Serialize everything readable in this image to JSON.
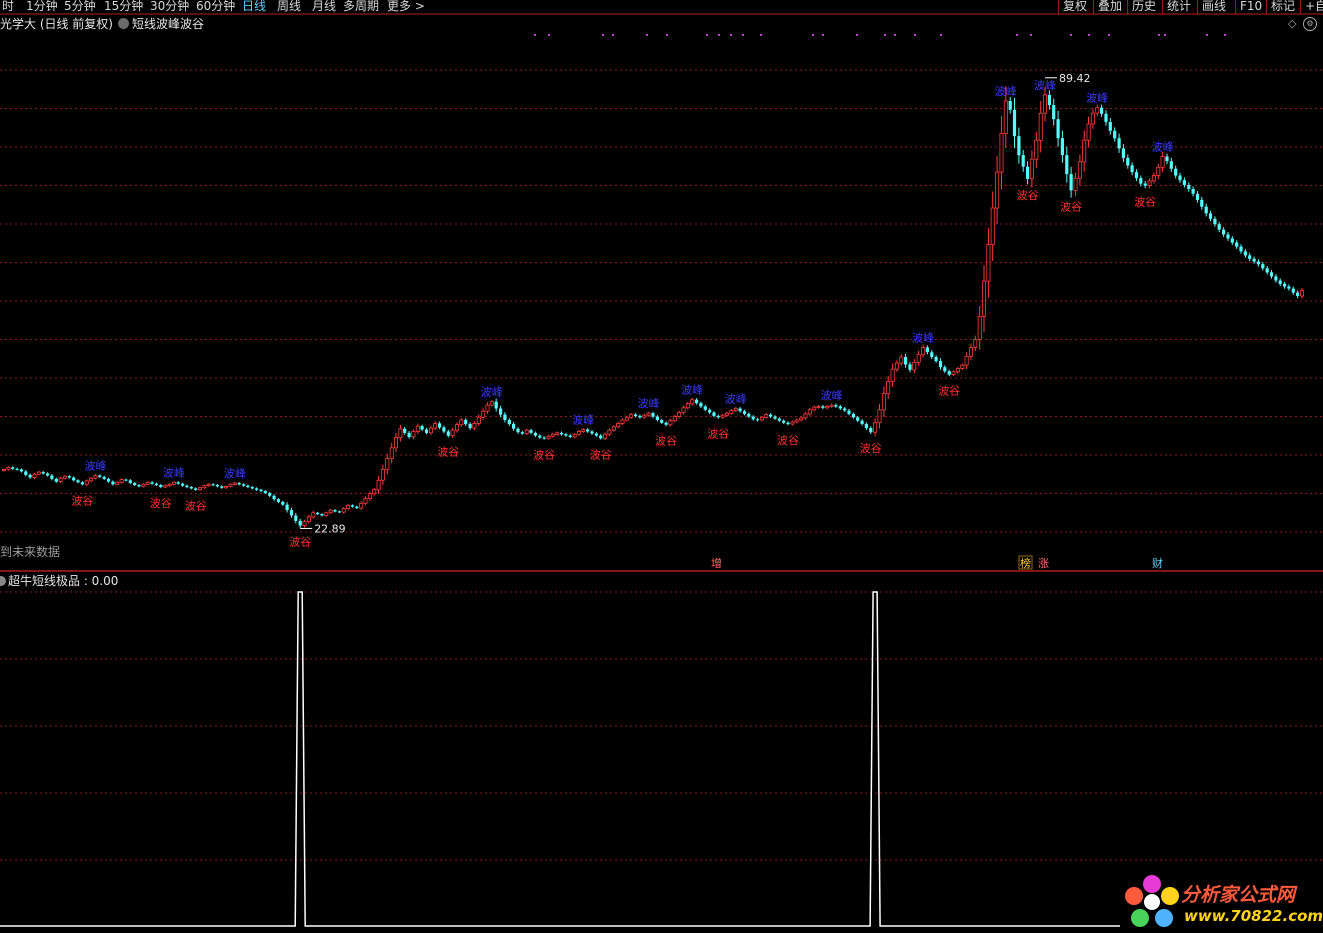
{
  "toolbar": {
    "periods": [
      "时",
      "1分钟",
      "5分钟",
      "15分钟",
      "30分钟",
      "60分钟",
      "日线",
      "周线",
      "月线",
      "多周期",
      "更多"
    ],
    "active_period": "日线",
    "right_buttons": [
      "复权",
      "叠加",
      "历史",
      "统计",
      "画线",
      "F10",
      "标记",
      "+自"
    ]
  },
  "header": {
    "stock_title": "光学大 (日线 前复权)",
    "indicator_name": "短线波峰波谷"
  },
  "main_panel": {
    "no_future_text": "到未来数据",
    "high_label": "89.42",
    "low_label": "22.89",
    "event_markers": [
      "增",
      "榜",
      "涨",
      "财"
    ]
  },
  "sub_panel": {
    "title": "超牛短线极品 : 0.00"
  },
  "watermark": {
    "line1": "分析家公式网",
    "line2": "www.70822.com"
  },
  "colors": {
    "up": "#ff3c3c",
    "down": "#54ffff",
    "grid": "#8b1a1a",
    "peak_label": "#3a3aff",
    "trough_label": "#ff3030",
    "signal": "#ffffff"
  },
  "chart_data": [
    {
      "type": "candlestick",
      "title": "短线波峰波谷",
      "ylim": [
        20,
        95
      ],
      "high": 89.42,
      "low": 22.89,
      "peak_label": "波峰",
      "trough_label": "波谷",
      "closes": [
        31.6,
        31.9,
        31.7,
        31.6,
        31.3,
        30.8,
        30.4,
        30.9,
        31.2,
        31.0,
        30.7,
        30.2,
        29.8,
        30.3,
        30.6,
        30.4,
        30.0,
        29.7,
        29.4,
        29.9,
        30.3,
        30.7,
        30.5,
        30.2,
        29.8,
        29.4,
        29.7,
        30.1,
        30.0,
        29.6,
        29.3,
        29.1,
        29.4,
        29.7,
        29.5,
        29.3,
        29.0,
        29.2,
        29.4,
        29.7,
        29.5,
        29.2,
        29.0,
        28.8,
        28.6,
        28.9,
        29.2,
        29.4,
        29.3,
        29.1,
        28.9,
        29.1,
        29.4,
        29.6,
        29.4,
        29.2,
        29.0,
        28.8,
        28.6,
        28.4,
        28.1,
        27.7,
        27.2,
        26.8,
        26.4,
        25.6,
        24.8,
        24.0,
        23.3,
        23.9,
        24.6,
        25.2,
        25.0,
        24.8,
        25.2,
        25.6,
        25.4,
        25.3,
        25.8,
        26.3,
        26.1,
        25.9,
        26.6,
        27.3,
        28.0,
        28.6,
        30.0,
        31.6,
        33.2,
        34.8,
        36.3,
        37.6,
        37.0,
        36.4,
        37.2,
        38.0,
        37.5,
        37.0,
        37.7,
        38.4,
        37.8,
        37.2,
        36.6,
        37.4,
        38.2,
        38.9,
        38.3,
        37.7,
        38.4,
        39.3,
        40.2,
        41.1,
        41.6,
        40.6,
        39.7,
        38.9,
        38.3,
        37.6,
        37.1,
        36.9,
        37.4,
        37.0,
        36.6,
        36.3,
        36.2,
        36.5,
        36.8,
        37.0,
        36.8,
        36.6,
        36.4,
        36.8,
        37.2,
        37.5,
        37.2,
        36.9,
        36.6,
        36.2,
        36.8,
        37.4,
        37.9,
        38.4,
        38.9,
        39.3,
        39.7,
        39.5,
        39.3,
        39.6,
        39.9,
        39.4,
        38.9,
        38.5,
        38.2,
        38.8,
        39.4,
        40.0,
        40.7,
        41.3,
        41.9,
        41.4,
        40.9,
        40.4,
        40.0,
        39.5,
        39.3,
        39.6,
        39.9,
        40.3,
        40.6,
        40.2,
        39.8,
        39.4,
        39.0,
        38.9,
        39.3,
        39.7,
        39.4,
        39.1,
        38.8,
        38.5,
        38.3,
        38.6,
        38.9,
        39.2,
        39.8,
        40.4,
        40.8,
        40.9,
        40.7,
        40.9,
        41.1,
        40.9,
        40.6,
        40.3,
        39.8,
        39.3,
        38.8,
        38.3,
        37.7,
        37.1,
        38.5,
        40.4,
        42.8,
        44.6,
        46.4,
        47.3,
        48.2,
        47.1,
        46.3,
        47.4,
        48.6,
        49.6,
        48.9,
        48.2,
        47.6,
        46.7,
        46.1,
        45.6,
        46.0,
        46.5,
        47.0,
        48.3,
        49.6,
        50.8,
        54.2,
        59.4,
        64.8,
        70.2,
        75.5,
        81.2,
        86.0,
        84.7,
        80.8,
        78.0,
        76.3,
        74.5,
        77.4,
        80.2,
        84.2,
        86.9,
        85.4,
        83.3,
        80.5,
        78.0,
        75.2,
        72.8,
        74.6,
        77.0,
        80.2,
        82.6,
        84.2,
        85.0,
        84.1,
        82.9,
        81.6,
        80.5,
        79.0,
        77.6,
        76.5,
        75.5,
        74.6,
        73.8,
        73.5,
        74.2,
        75.0,
        76.2,
        77.8,
        77.1,
        76.0,
        75.0,
        74.3,
        73.6,
        73.0,
        72.3,
        71.4,
        70.4,
        69.4,
        68.6,
        67.8,
        67.0,
        66.3,
        65.7,
        65.1,
        64.5,
        63.8,
        63.2,
        62.7,
        62.3,
        61.9,
        61.3,
        60.7,
        60.1,
        59.5,
        59.0,
        58.6,
        58.3,
        57.7,
        57.2,
        58.0
      ]
    },
    {
      "type": "line",
      "title": "超牛短线极品",
      "value": 0.0,
      "spikes": [
        {
          "bar_index": 68,
          "value": 1
        },
        {
          "bar_index": 200,
          "value": 1
        }
      ]
    }
  ]
}
